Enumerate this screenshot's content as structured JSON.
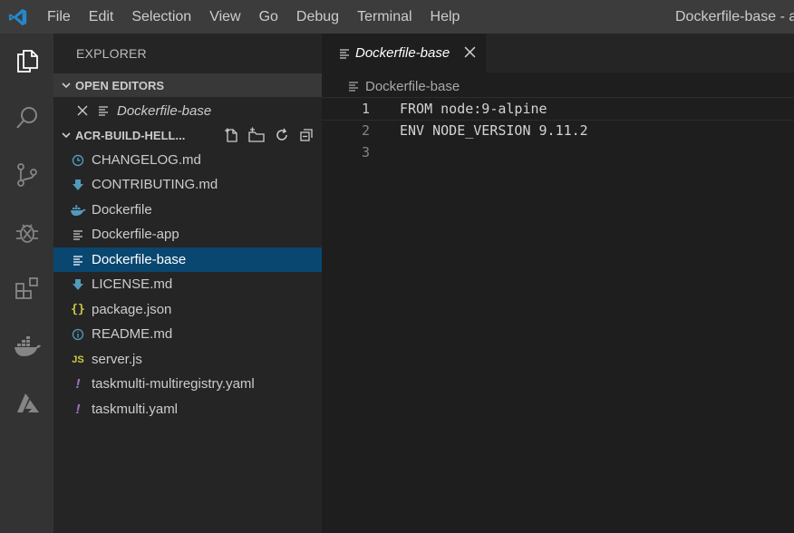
{
  "menu": {
    "items": [
      "File",
      "Edit",
      "Selection",
      "View",
      "Go",
      "Debug",
      "Terminal",
      "Help"
    ],
    "window_title": "Dockerfile-base - ac"
  },
  "activity_bar": {
    "icons": [
      "explorer-icon",
      "search-icon",
      "source-control-icon",
      "debug-icon",
      "extensions-icon",
      "docker-icon",
      "azure-icon"
    ]
  },
  "sidebar": {
    "title": "EXPLORER",
    "open_editors": {
      "header": "OPEN EDITORS",
      "items": [
        {
          "label": "Dockerfile-base",
          "icon": "file-lines-icon"
        }
      ]
    },
    "folder": {
      "header": "ACR-BUILD-HELL...",
      "actions": [
        "new-file-icon",
        "new-folder-icon",
        "refresh-icon",
        "collapse-all-icon"
      ],
      "files": [
        {
          "label": "CHANGELOG.md",
          "icon": "clock-icon"
        },
        {
          "label": "CONTRIBUTING.md",
          "icon": "download-arrow-icon"
        },
        {
          "label": "Dockerfile",
          "icon": "docker-whale-icon"
        },
        {
          "label": "Dockerfile-app",
          "icon": "file-lines-icon"
        },
        {
          "label": "Dockerfile-base",
          "icon": "file-lines-icon",
          "selected": true
        },
        {
          "label": "LICENSE.md",
          "icon": "download-arrow-icon"
        },
        {
          "label": "package.json",
          "icon": "json-braces-icon"
        },
        {
          "label": "README.md",
          "icon": "info-icon"
        },
        {
          "label": "server.js",
          "icon": "js-icon"
        },
        {
          "label": "taskmulti-multiregistry.yaml",
          "icon": "exclamation-icon"
        },
        {
          "label": "taskmulti.yaml",
          "icon": "exclamation-icon"
        }
      ]
    }
  },
  "editor": {
    "tab_label": "Dockerfile-base",
    "breadcrumb": "Dockerfile-base",
    "lines": [
      {
        "number": "1",
        "text": "FROM node:9-alpine"
      },
      {
        "number": "2",
        "text": "ENV NODE_VERSION 9.11.2"
      },
      {
        "number": "3",
        "text": ""
      }
    ]
  },
  "colors": {
    "selection": "#094771",
    "accent": "#007acc",
    "yaml": "#a074c4",
    "json": "#cbcb41",
    "markdown": "#519aba",
    "docker": "#519aba"
  },
  "chart_data": null
}
